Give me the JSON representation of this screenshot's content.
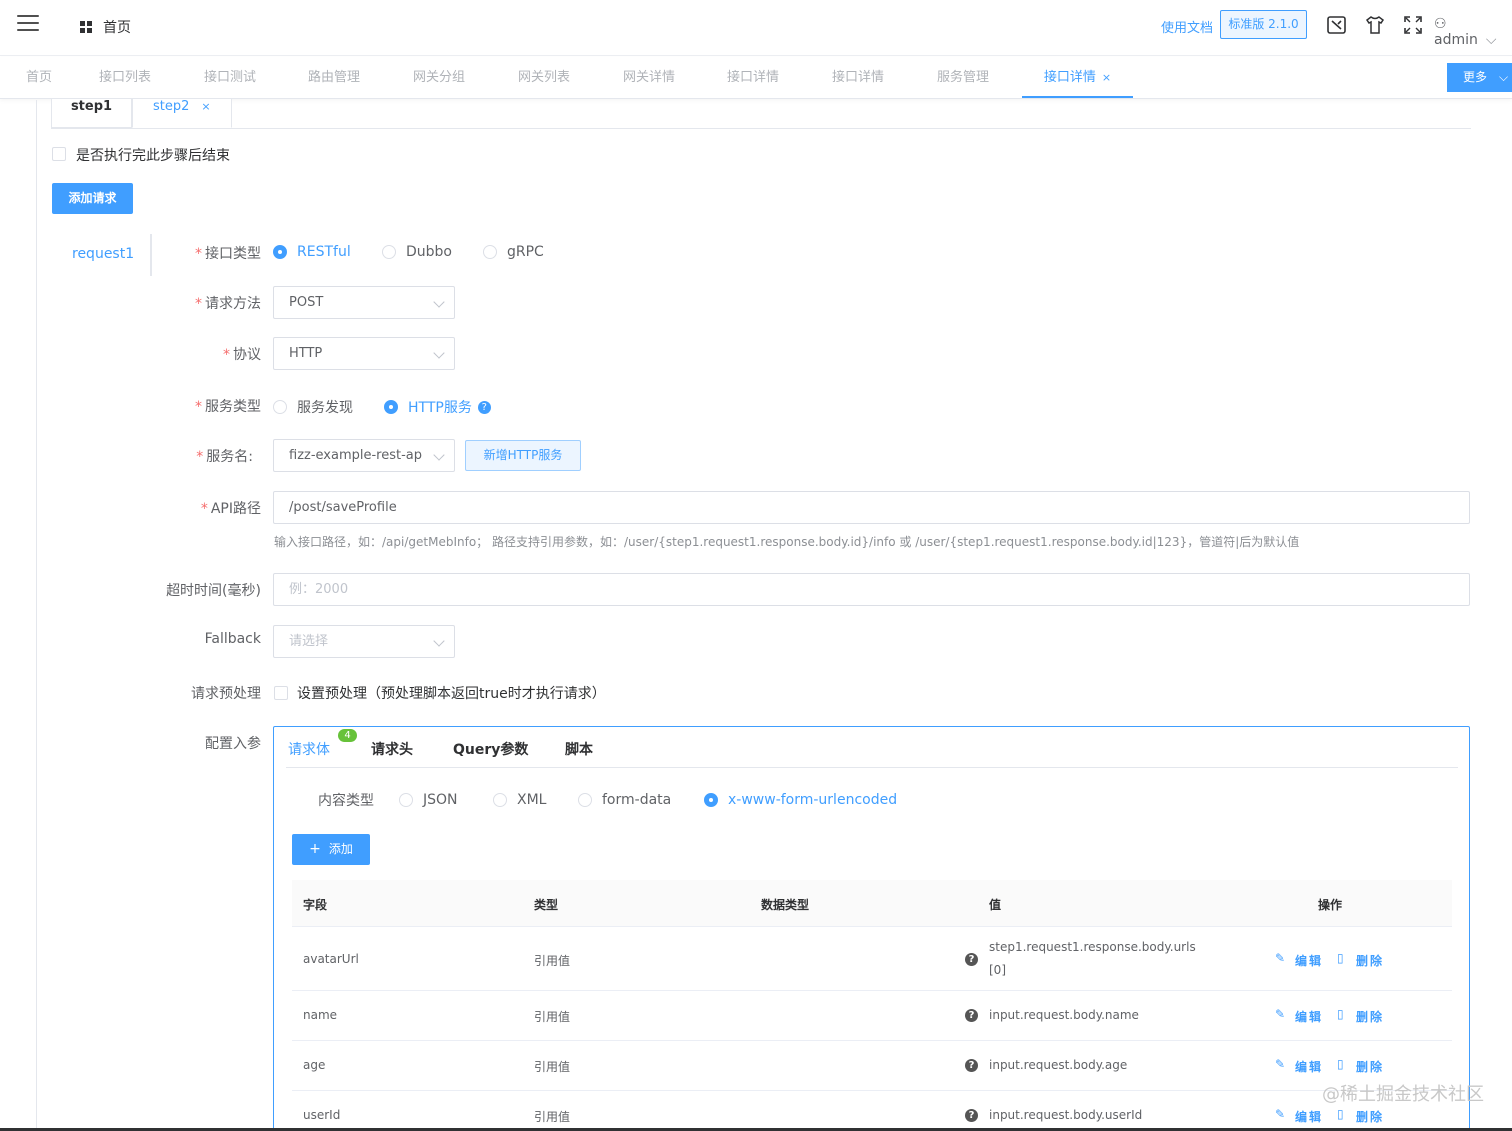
{
  "header": {
    "home_title": "首页",
    "docs_link": "使用文档",
    "version_badge": "标准版 2.1.0",
    "user": "admin"
  },
  "tabs": [
    {
      "label": "首页"
    },
    {
      "label": "接口列表"
    },
    {
      "label": "接口测试"
    },
    {
      "label": "路由管理"
    },
    {
      "label": "网关分组"
    },
    {
      "label": "网关列表"
    },
    {
      "label": "网关详情"
    },
    {
      "label": "接口详情"
    },
    {
      "label": "接口详情"
    },
    {
      "label": "服务管理"
    },
    {
      "label": "接口详情",
      "close": "×"
    }
  ],
  "more_button": "更多",
  "steps": {
    "step1": "step1",
    "step2": "step2",
    "step2_close": "×"
  },
  "end_after_step_label": "是否执行完此步骤后结束",
  "add_request_button": "添加请求",
  "request_nav": "request1",
  "form": {
    "interface_type": {
      "label": "接口类型",
      "options": [
        "RESTful",
        "Dubbo",
        "gRPC"
      ],
      "selected": "RESTful"
    },
    "method": {
      "label": "请求方法",
      "value": "POST"
    },
    "protocol": {
      "label": "协议",
      "value": "HTTP"
    },
    "service_type": {
      "label": "服务类型",
      "options": [
        "服务发现",
        "HTTP服务"
      ],
      "selected": "HTTP服务",
      "help": "?"
    },
    "service_name": {
      "label": "服务名:",
      "value": "fizz-example-rest-ap",
      "add_button": "新增HTTP服务"
    },
    "api_path": {
      "label": "API路径",
      "value": "/post/saveProfile",
      "help": "输入接口路径，如：/api/getMebInfo；  路径支持引用参数，如：/user/{step1.request1.response.body.id}/info 或 /user/{step1.request1.response.body.id|123}，管道符|后为默认值"
    },
    "timeout": {
      "label": "超时时间(毫秒)",
      "placeholder": "例：2000"
    },
    "fallback": {
      "label": "Fallback",
      "placeholder": "请选择"
    },
    "preprocess": {
      "label": "请求预处理",
      "checkbox_label": "设置预处理（预处理脚本返回true时才执行请求）"
    },
    "config_label": "配置入参"
  },
  "config": {
    "tabs": [
      {
        "label": "请求体",
        "badge": "4"
      },
      {
        "label": "请求头"
      },
      {
        "label": "Query参数"
      },
      {
        "label": "脚本"
      }
    ],
    "content_type": {
      "label": "内容类型",
      "options": [
        "JSON",
        "XML",
        "form-data",
        "x-www-form-urlencoded"
      ],
      "selected": "x-www-form-urlencoded"
    },
    "add_button": "添加",
    "add_icon": "+",
    "columns": [
      "字段",
      "类型",
      "数据类型",
      "值",
      "操作"
    ],
    "rows": [
      {
        "field": "avatarUrl",
        "type": "引用值",
        "data_type": "",
        "value_line1": "step1.request1.response.body.urls",
        "value_line2": "[0]"
      },
      {
        "field": "name",
        "type": "引用值",
        "data_type": "",
        "value_line1": "input.request.body.name",
        "value_line2": ""
      },
      {
        "field": "age",
        "type": "引用值",
        "data_type": "",
        "value_line1": "input.request.body.age",
        "value_line2": ""
      },
      {
        "field": "userId",
        "type": "引用值",
        "data_type": "",
        "value_line1": "input.request.body.userId",
        "value_line2": ""
      }
    ],
    "edit_label": "编辑",
    "delete_label": "删除",
    "help_glyph": "?"
  },
  "watermark": "@稀土掘金技术社区",
  "colors": {
    "primary": "#409eff",
    "required": "#f56c6c",
    "badge": "#67c23a"
  }
}
